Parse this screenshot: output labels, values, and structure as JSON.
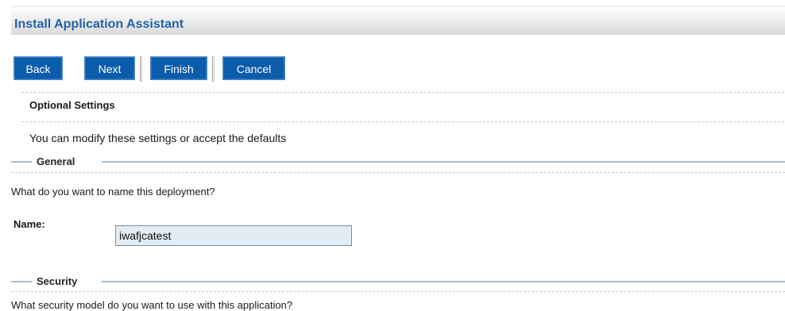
{
  "header": {
    "title": "Install Application Assistant"
  },
  "toolbar": {
    "back_label": "Back",
    "next_label": "Next",
    "finish_label": "Finish",
    "cancel_label": "Cancel"
  },
  "optional": {
    "heading": "Optional Settings",
    "description": "You can modify these settings or accept the defaults"
  },
  "general": {
    "legend": "General",
    "prompt": "What do you want to name this deployment?",
    "name_label": "Name:",
    "name_value": "iwafjcatest"
  },
  "security": {
    "legend": "Security",
    "prompt": "What security model do you want to use with this application?"
  },
  "colors": {
    "button_bg": "#0b5cab",
    "title_color": "#2463a6",
    "input_bg": "#e2ecf4"
  }
}
